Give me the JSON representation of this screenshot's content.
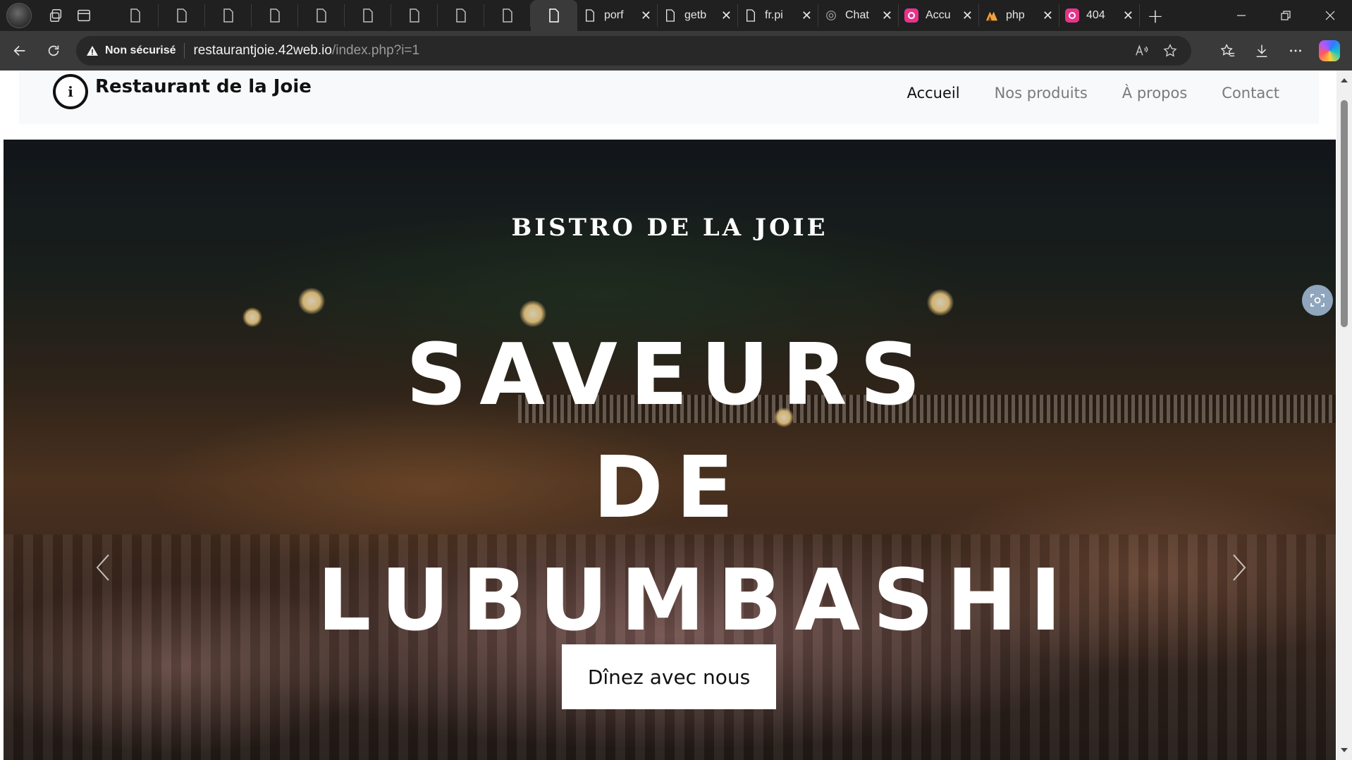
{
  "browser": {
    "tabs": [
      {
        "title": "porf",
        "favicon": "document-icon"
      },
      {
        "title": "getb",
        "favicon": "document-icon"
      },
      {
        "title": "fr.pi",
        "favicon": "document-icon"
      },
      {
        "title": "Chat",
        "favicon": "openai-icon"
      },
      {
        "title": "Accu",
        "favicon": "pink-app-icon"
      },
      {
        "title": "php",
        "favicon": "triangle-icon"
      },
      {
        "title": "404",
        "favicon": "pink-app-icon"
      }
    ],
    "pinned_tab_count": 10,
    "security_label": "Non sécurisé",
    "url_host": "restaurantjoie.42web.io",
    "url_path": "/index.php?i=1"
  },
  "site": {
    "brand": "Restaurant de la Joie",
    "logo_text": "i",
    "nav": [
      {
        "label": "Accueil",
        "active": true
      },
      {
        "label": "Nos produits",
        "active": false
      },
      {
        "label": "À propos",
        "active": false
      },
      {
        "label": "Contact",
        "active": false
      }
    ]
  },
  "hero": {
    "kicker": "BISTRO DE LA JOIE",
    "title_line1": "SAVEURS DE",
    "title_line2": "LUBUMBASHI",
    "cta": "Dînez avec nous"
  },
  "colors": {
    "browser_bg": "#202020",
    "toolbar_bg": "#3a3a3a",
    "nav_bg": "#f8f9fa",
    "accent_pink": "#e8338a"
  }
}
